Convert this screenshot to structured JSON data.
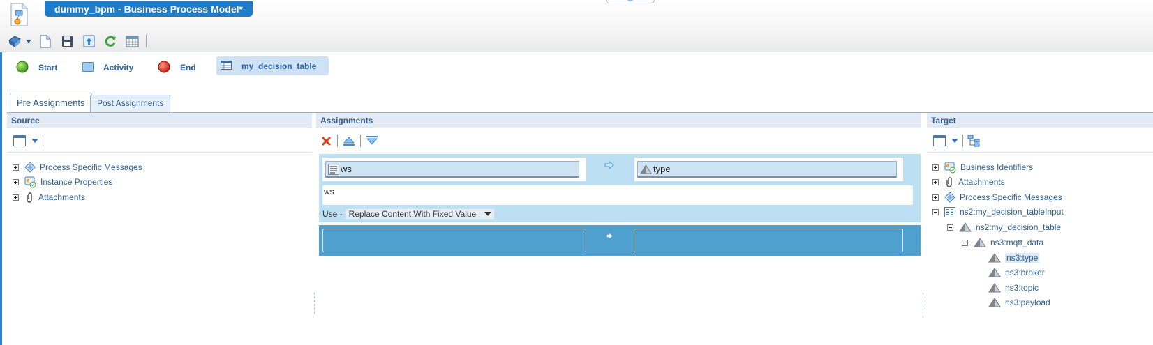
{
  "app": {
    "title": "dummy_bpm - Business Process Model*",
    "accent": "#1f7cc9"
  },
  "toolbar": {
    "items": [
      "process-menu-icon",
      "new-document-icon",
      "save-icon",
      "deploy-icon",
      "refresh-icon",
      "calendar-icon"
    ]
  },
  "palette": {
    "start": "Start",
    "activity": "Activity",
    "end": "End",
    "decision_table": "my_decision_table"
  },
  "tabs": {
    "pre": "Pre Assignments",
    "post": "Post Assignments"
  },
  "source": {
    "header": "Source",
    "tree": [
      {
        "label": "Process Specific Messages",
        "icon": "messages-icon"
      },
      {
        "label": "Instance Properties",
        "icon": "instance-properties-icon"
      },
      {
        "label": "Attachments",
        "icon": "paperclip-icon"
      }
    ]
  },
  "assignments": {
    "header": "Assignments",
    "row1": {
      "source_value": "ws",
      "target_value": "type",
      "text_value": "ws",
      "use_label": "Use -",
      "use_option": "Replace Content With Fixed Value"
    }
  },
  "target": {
    "header": "Target",
    "tree": [
      {
        "label": "Business Identifiers"
      },
      {
        "label": "Attachments"
      },
      {
        "label": "Process Specific Messages"
      },
      {
        "label": "ns2:my_decision_tableInput"
      },
      {
        "label": "ns2:my_decision_table"
      },
      {
        "label": "ns3:mqtt_data"
      },
      {
        "label": "ns3:type"
      },
      {
        "label": "ns3:broker"
      },
      {
        "label": "ns3:topic"
      },
      {
        "label": "ns3:payload"
      }
    ]
  }
}
